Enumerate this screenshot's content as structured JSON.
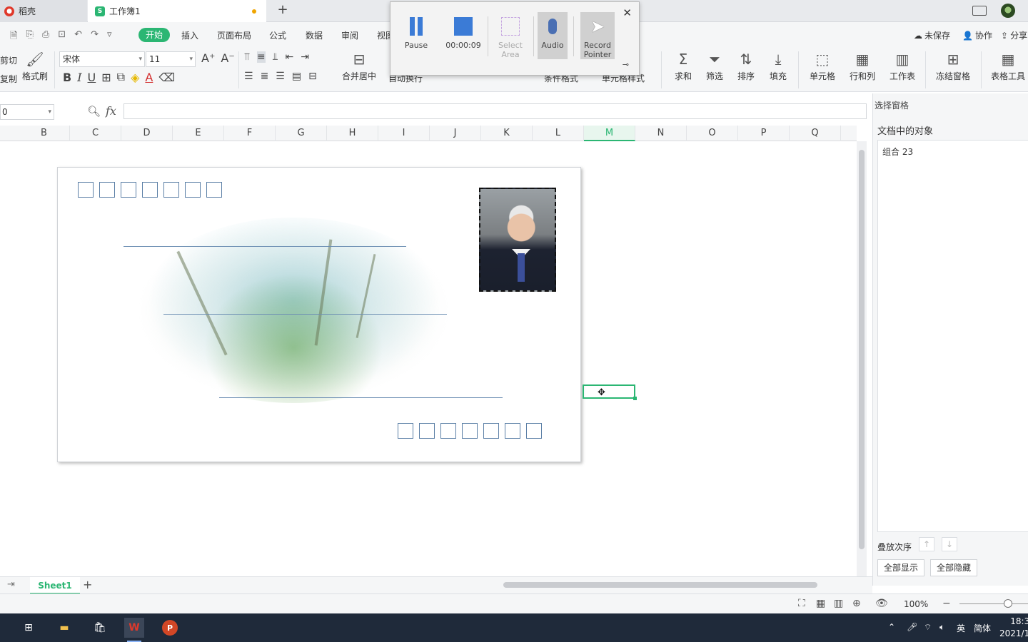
{
  "tabs": [
    {
      "label": "稻壳",
      "badge": "●"
    },
    {
      "label": "工作簿1",
      "badge": "S"
    }
  ],
  "menu": {
    "start": "开始",
    "items": [
      "插入",
      "页面布局",
      "公式",
      "数据",
      "审阅",
      "视图"
    ],
    "right": [
      "未保存",
      "协作",
      "分享"
    ]
  },
  "ribbon": {
    "cut": "剪切",
    "copy": "复制",
    "format_painter": "格式刷",
    "font_name": "宋体",
    "font_size": "11",
    "merge_center": "合并居中",
    "wrap_text": "自动换行",
    "cond_format": "条件格式",
    "cell_style": "单元格样式",
    "sum": "求和",
    "filter": "筛选",
    "sort": "排序",
    "fill": "填充",
    "cell": "单元格",
    "row_col": "行和列",
    "worksheet": "工作表",
    "freeze": "冻结窗格",
    "table_tools": "表格工具"
  },
  "formula": {
    "name_box": "0",
    "fx": "fx"
  },
  "columns": [
    "B",
    "C",
    "D",
    "E",
    "F",
    "G",
    "H",
    "I",
    "J",
    "K",
    "L",
    "M",
    "N",
    "O",
    "P",
    "Q"
  ],
  "active_column": "M",
  "right_pane": {
    "title": "选择窗格",
    "objects_label": "文档中的对象",
    "object_item": "组合 23",
    "order_label": "叠放次序",
    "show_all": "全部显示",
    "hide_all": "全部隐藏"
  },
  "sheet_tab": "Sheet1",
  "status": {
    "zoom": "100%",
    "lang": "英",
    "ime": "简体",
    "time": "18:3",
    "date": "2021/1"
  },
  "recorder": {
    "pause": "Pause",
    "timer": "00:00:09",
    "select_area": "Select Area",
    "audio": "Audio",
    "record_pointer": "Record Pointer"
  },
  "colors": {
    "accent": "#2bb673",
    "recorder_blue": "#3b7bd6",
    "envelope_line": "#6d8fb3"
  }
}
